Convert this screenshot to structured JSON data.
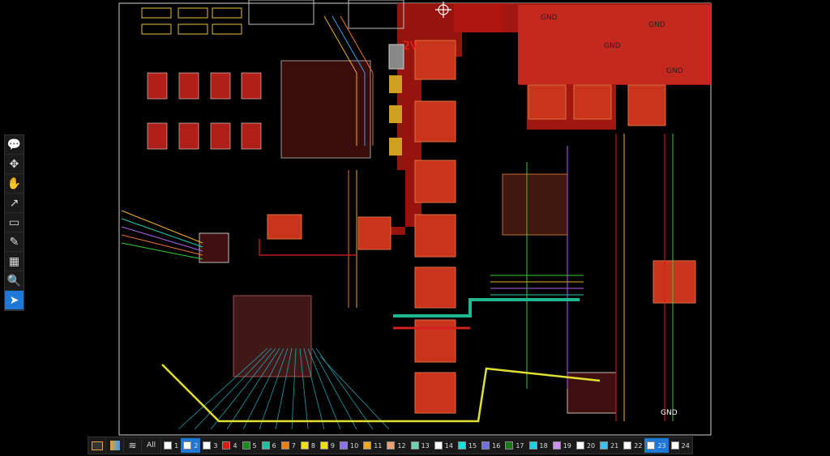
{
  "board": {
    "labels": {
      "gnd_1": "GND",
      "gnd_2": "GND",
      "gnd_3": "GND",
      "gnd_4": "GND",
      "gnd_5": "GND",
      "net_2v": "2V"
    }
  },
  "toolbar": {
    "tools": [
      {
        "name": "comment-icon",
        "glyph": "💬"
      },
      {
        "name": "move-icon",
        "glyph": "✥"
      },
      {
        "name": "pan-hand-icon",
        "glyph": "✋"
      },
      {
        "name": "route-icon",
        "glyph": "↗"
      },
      {
        "name": "add-shape-icon",
        "glyph": "▭"
      },
      {
        "name": "probe-icon",
        "glyph": "✎"
      },
      {
        "name": "layer-add-icon",
        "glyph": "▦"
      },
      {
        "name": "zoom-icon",
        "glyph": "🔍"
      },
      {
        "name": "select-pointer-icon",
        "glyph": "➤"
      }
    ]
  },
  "layer_bar": {
    "all_label": "All",
    "layers": [
      {
        "label": "1",
        "color": "#ffffff"
      },
      {
        "label": "2",
        "color": "#ffffff",
        "active": true
      },
      {
        "label": "3",
        "color": "#ffffff"
      },
      {
        "label": "4",
        "color": "#e01818"
      },
      {
        "label": "5",
        "color": "#1c8a1c"
      },
      {
        "label": "6",
        "color": "#20c3a0"
      },
      {
        "label": "7",
        "color": "#f07a18"
      },
      {
        "label": "8",
        "color": "#f0e018"
      },
      {
        "label": "9",
        "color": "#f0e018"
      },
      {
        "label": "10",
        "color": "#9070f0"
      },
      {
        "label": "11",
        "color": "#f0a818"
      },
      {
        "label": "12",
        "color": "#f0a070"
      },
      {
        "label": "13",
        "color": "#70d0b0"
      },
      {
        "label": "14",
        "color": "#ffffff"
      },
      {
        "label": "15",
        "color": "#18e0e0"
      },
      {
        "label": "16",
        "color": "#7070e0"
      },
      {
        "label": "17",
        "color": "#1a7a1a"
      },
      {
        "label": "18",
        "color": "#20d0e0"
      },
      {
        "label": "19",
        "color": "#d090f0"
      },
      {
        "label": "20",
        "color": "#ffffff"
      },
      {
        "label": "21",
        "color": "#40c0f0"
      },
      {
        "label": "22",
        "color": "#ffffff"
      },
      {
        "label": "23",
        "color": "#ffffff",
        "active": true
      },
      {
        "label": "24",
        "color": "#ffffff"
      }
    ]
  }
}
